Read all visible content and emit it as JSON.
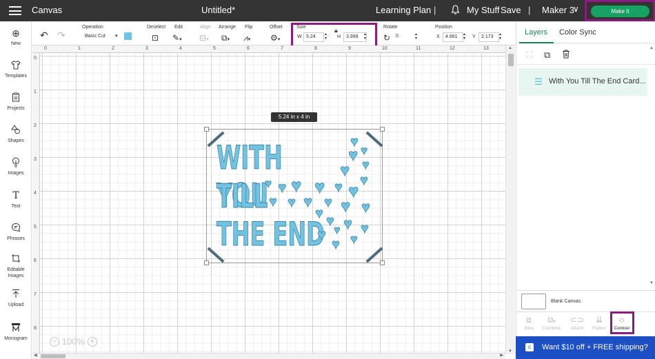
{
  "topbar": {
    "app_title": "Canvas",
    "doc_title": "Untitled*",
    "learning_plan": "Learning Plan",
    "sep1": "|",
    "bell_icon": "bell-icon",
    "my_stuff": "My Stuff",
    "save": "Save",
    "sep2": "|",
    "machine": "Maker 3",
    "chevron": "∨",
    "make_it": "Make It",
    "make_it_color": "#17a163",
    "highlight_color": "#8a1b7f"
  },
  "toolbar": {
    "operation_label": "Operation",
    "operation_value": "Basic Cut",
    "operation_color": "#74c2e1",
    "deselect_label": "Deselect",
    "edit_label": "Edit",
    "align_label": "Align",
    "arrange_label": "Arrange",
    "flip_label": "Flip",
    "offset_label": "Offset",
    "size_label": "Size",
    "size_w_label": "W",
    "size_w": "5.24",
    "size_h_label": "H",
    "size_h": "3.999",
    "rotate_label": "Rotate",
    "rotate_value": "0",
    "position_label": "Position",
    "pos_x_label": "X",
    "pos_x": "4.861",
    "pos_y_label": "Y",
    "pos_y": "2.173"
  },
  "sidebar": {
    "items": [
      {
        "label": "New",
        "icon": "plus-circle-icon"
      },
      {
        "label": "Templates",
        "icon": "shirt-icon"
      },
      {
        "label": "Projects",
        "icon": "projects-icon"
      },
      {
        "label": "Shapes",
        "icon": "shapes-icon"
      },
      {
        "label": "Images",
        "icon": "lightbulb-icon"
      },
      {
        "label": "Text",
        "icon": "text-icon"
      },
      {
        "label": "Phrases",
        "icon": "speech-bubble-icon"
      },
      {
        "label": "Editable Images",
        "icon": "editable-images-icon"
      },
      {
        "label": "Upload",
        "icon": "upload-icon"
      },
      {
        "label": "Monogram",
        "icon": "monogram-icon"
      }
    ]
  },
  "rulers": {
    "top": [
      "0",
      "1",
      "2",
      "3",
      "4",
      "5",
      "6",
      "7",
      "8",
      "9",
      "10",
      "11",
      "12",
      "13"
    ],
    "left": [
      "0",
      "1",
      "2",
      "3",
      "4",
      "5",
      "6",
      "7",
      "8"
    ]
  },
  "canvas": {
    "dimension_tooltip": "5.24  in x 4  in",
    "zoom_level": "100%",
    "zoom_minus": "−",
    "zoom_plus": "+",
    "design_text": [
      "WITH YOU",
      "TILL",
      "THE END"
    ],
    "design_color": "#74c2e1"
  },
  "right_panel": {
    "tab_layers": "Layers",
    "tab_color_sync": "Color Sync",
    "layer_name": "With You Till The End Card...",
    "blank_canvas": "Blank Canvas",
    "bottom_tools": [
      "Slice",
      "Combine",
      "Attach",
      "Flatten",
      "Contour"
    ],
    "promo": "Want $10 off + FREE shipping?"
  }
}
